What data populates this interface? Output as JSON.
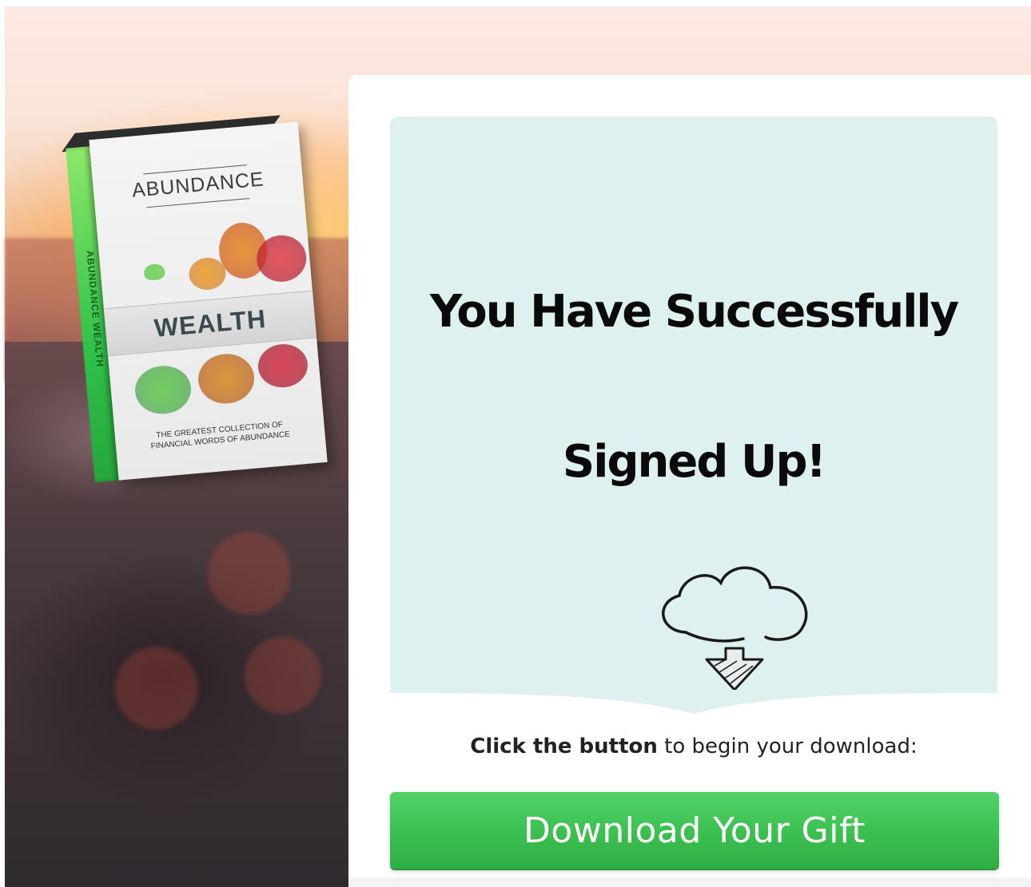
{
  "book": {
    "title_top": "ABUNDANCE",
    "title_main": "WEALTH",
    "subtitle_line1": "THE GREATEST COLLECTION OF",
    "subtitle_line2": "FINANCIAL WORDS OF ABUNDANCE",
    "spine_text": "ABUNDANCE WEALTH"
  },
  "confirmation": {
    "headline_line1": "You Have Successfully",
    "headline_line2": "Signed Up!",
    "icon": "cloud-download-icon"
  },
  "instruction": {
    "bold": "Click the button",
    "rest": " to begin your download:"
  },
  "download_button": {
    "label": "Download Your Gift",
    "color": "#3bbf4f"
  },
  "colors": {
    "panel_background": "#dff0f1",
    "card_background": "#ffffff"
  }
}
